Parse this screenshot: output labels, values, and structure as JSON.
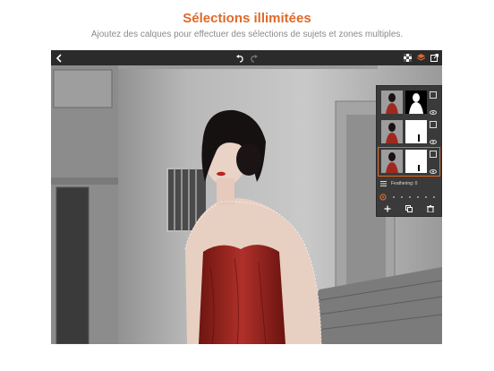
{
  "header": {
    "title": "Sélections illimitées",
    "subtitle": "Ajoutez des calques pour effectuer des sélections de sujets et zones multiples."
  },
  "toolbar": {
    "back_icon": "chevron-left-icon",
    "undo_icon": "undo-icon",
    "redo_icon": "redo-icon",
    "checker_icon": "transparency-grid-icon",
    "layers_icon": "layers-icon",
    "export_icon": "export-icon",
    "accent": "#e0692a"
  },
  "layers_panel": {
    "layers": [
      {
        "mask": "silhouette-mask"
      },
      {
        "mask": "small-mask"
      },
      {
        "mask": "small-mask",
        "active": true
      }
    ],
    "feathering_label": "Feathering: 0",
    "slider_value": 0,
    "actions": [
      "add-icon",
      "duplicate-icon",
      "trash-icon"
    ]
  }
}
